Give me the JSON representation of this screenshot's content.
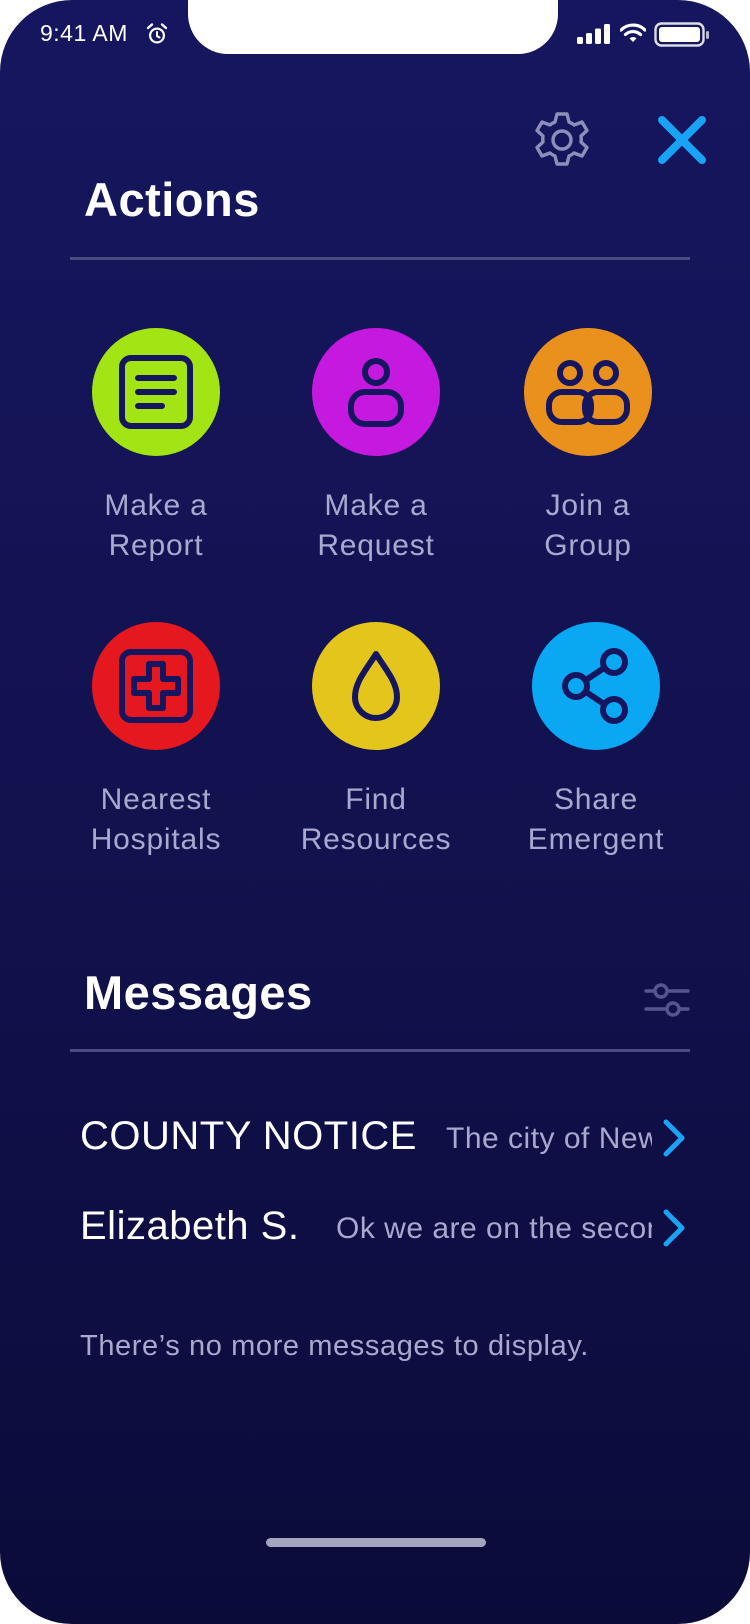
{
  "status_bar": {
    "time": "9:41 AM",
    "alarm_icon": "alarm-clock-icon",
    "signal_icon": "cellular-signal-icon",
    "wifi_icon": "wifi-icon",
    "battery_icon": "battery-icon"
  },
  "header": {
    "settings_icon": "gear-icon",
    "close_icon": "close-icon",
    "close_color": "#1aa3f5"
  },
  "actions": {
    "title": "Actions",
    "items": [
      {
        "label": "Make a\nReport",
        "icon": "report-document-icon",
        "color": "#a3e414"
      },
      {
        "label": "Make a\nRequest",
        "icon": "person-icon",
        "color": "#c619e0"
      },
      {
        "label": "Join a\nGroup",
        "icon": "group-icon",
        "color": "#e9911c"
      },
      {
        "label": "Nearest\nHospitals",
        "icon": "medical-cross-icon",
        "color": "#e5181f"
      },
      {
        "label": "Find\nResources",
        "icon": "water-drop-icon",
        "color": "#e4c51c"
      },
      {
        "label": "Share\nEmergent",
        "icon": "share-icon",
        "color": "#0aa8f2"
      }
    ]
  },
  "messages": {
    "title": "Messages",
    "filter_icon": "filter-sliders-icon",
    "items": [
      {
        "sender": "COUNTY NOTICE",
        "preview": "The city of New"
      },
      {
        "sender": "Elizabeth S.",
        "preview": "Ok we are on the second"
      }
    ],
    "empty_text": "There’s no more messages to display."
  }
}
